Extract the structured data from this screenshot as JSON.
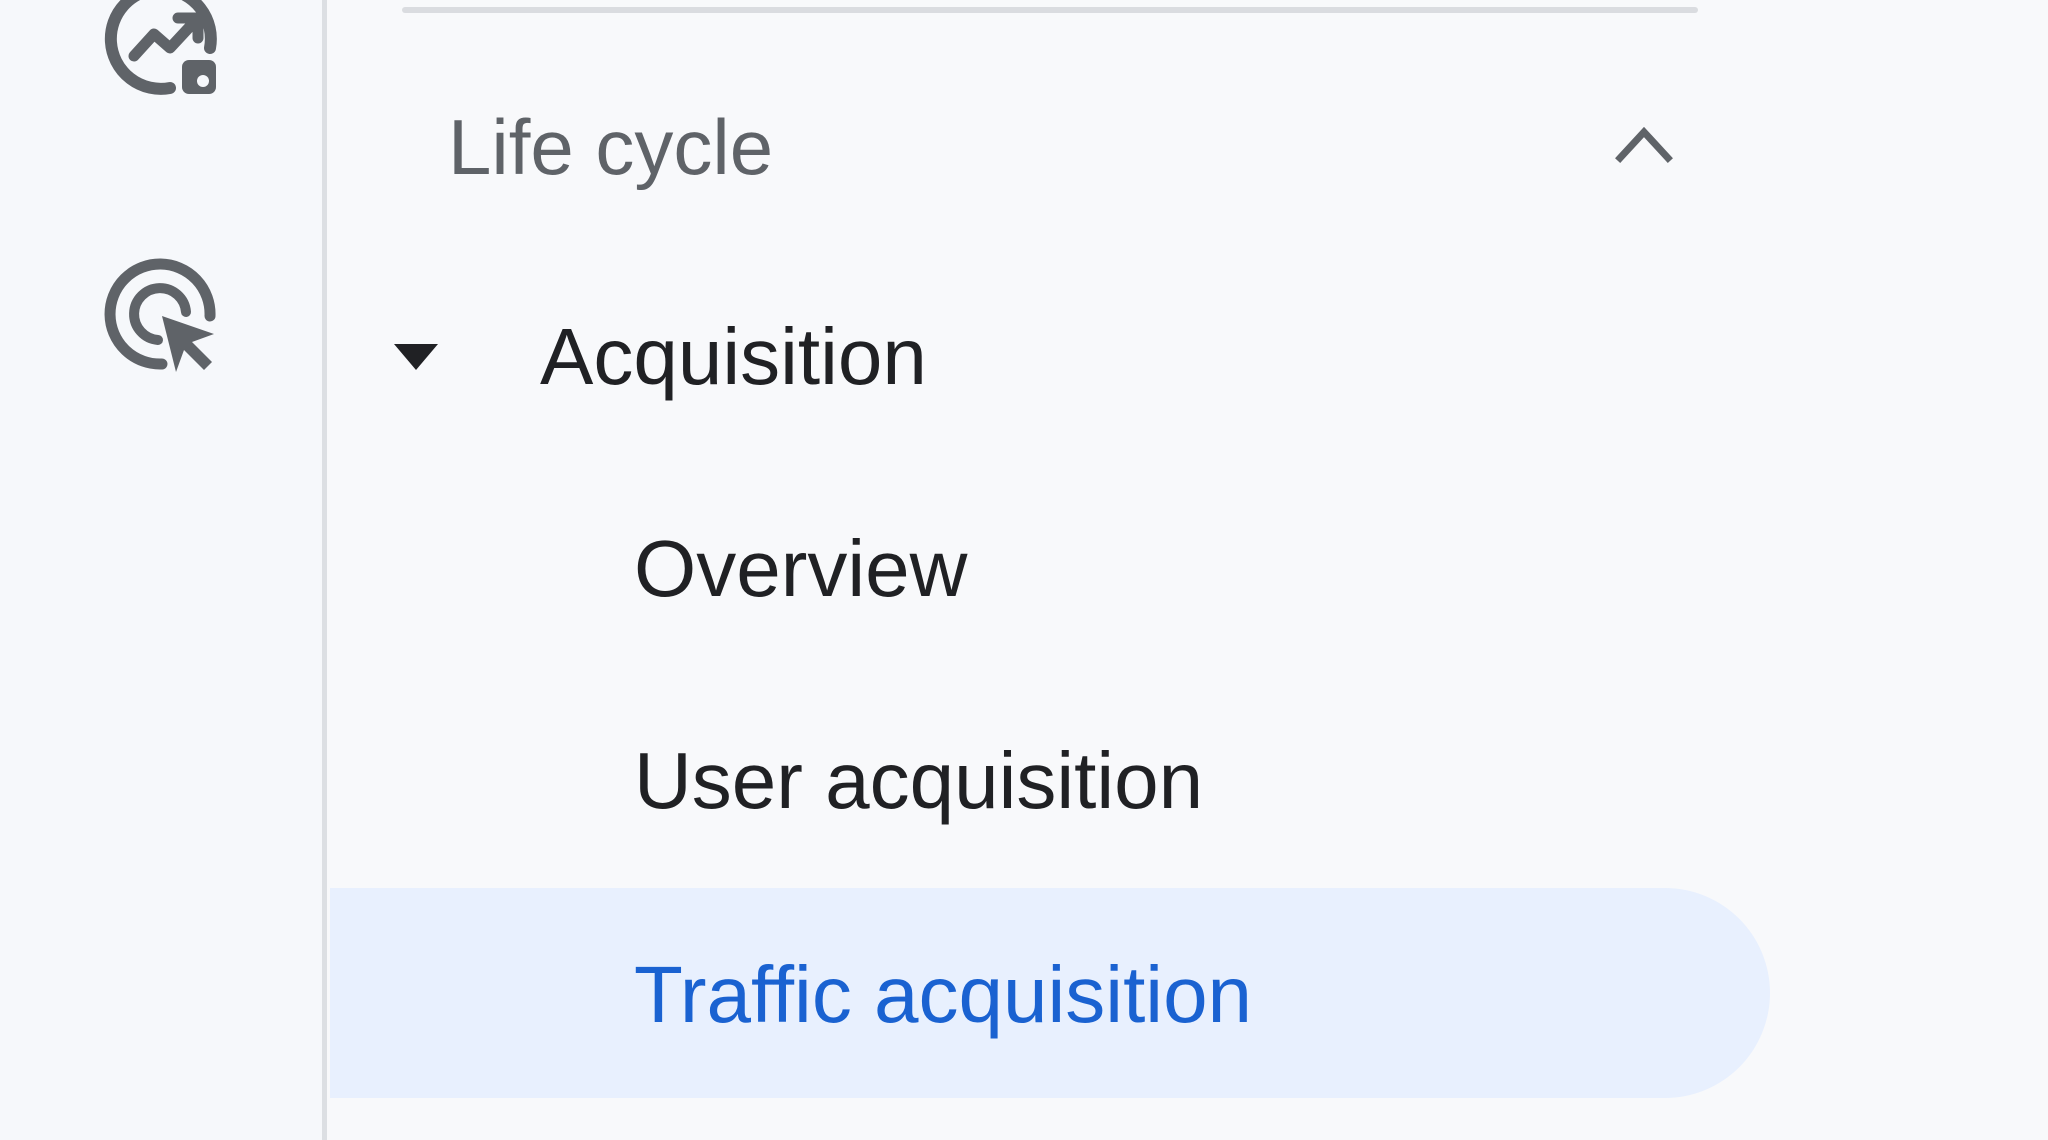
{
  "rail": {
    "icons": [
      {
        "name": "reports-snapshot-icon"
      },
      {
        "name": "explore-icon"
      }
    ]
  },
  "section": {
    "title": "Life cycle",
    "expanded": true,
    "toggle_icon": "chevron-up-icon"
  },
  "group": {
    "label": "Acquisition",
    "expanded": true,
    "toggle_icon": "caret-down-icon"
  },
  "items": [
    {
      "label": "Overview",
      "active": false
    },
    {
      "label": "User acquisition",
      "active": false
    },
    {
      "label": "Traffic acquisition",
      "active": true
    }
  ],
  "colors": {
    "active_background": "#e8f0fe",
    "active_text": "#1a62d1",
    "text_primary": "#202124",
    "text_secondary": "#5f6368",
    "icon": "#5f6368"
  }
}
